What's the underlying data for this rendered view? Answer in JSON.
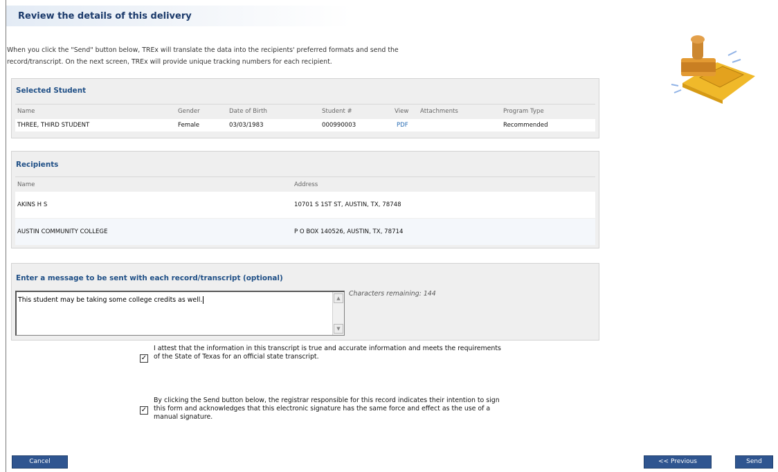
{
  "page": {
    "title": "Review the details of this delivery",
    "intro_line1": "When you click the \"Send\" button below, TREx will translate the data into the recipients' preferred formats and send the",
    "intro_line2": "record/transcript. On the next screen, TREx will provide unique tracking numbers for each recipient."
  },
  "student": {
    "section_title": "Selected Student",
    "headers": {
      "name": "Name",
      "gender": "Gender",
      "dob": "Date of Birth",
      "student_no": "Student #",
      "view": "View",
      "attachments": "Attachments",
      "program_type": "Program Type"
    },
    "row": {
      "name": "THREE, THIRD STUDENT",
      "gender": "Female",
      "dob": "03/03/1983",
      "student_no": "000990003",
      "view": "PDF",
      "attachments": "",
      "program_type": "Recommended"
    }
  },
  "recipients": {
    "section_title": "Recipients",
    "headers": {
      "name": "Name",
      "address": "Address"
    },
    "rows": [
      {
        "name": "AKINS H S",
        "address": "10701 S 1ST ST, AUSTIN, TX, 78748"
      },
      {
        "name": "AUSTIN COMMUNITY COLLEGE",
        "address": "P O BOX 140526, AUSTIN, TX, 78714"
      }
    ]
  },
  "message": {
    "section_title": "Enter a message to be sent with each record/transcript (optional)",
    "value": "This student may be taking some college credits as well.",
    "chars_remaining": "Characters remaining: 144"
  },
  "attestations": [
    {
      "checked": true,
      "line1": "I attest that the information in this transcript is true and accurate information and meets the requirements",
      "line2": "of the State of Texas for an official state transcript."
    },
    {
      "checked": true,
      "line1": "By clicking the Send button below, the registrar responsible for this record indicates their intention to sign",
      "line2": "this form and acknowledges that this electronic signature has the same force and effect as the use of a",
      "line3": "manual signature."
    }
  ],
  "buttons": {
    "cancel": "Cancel",
    "previous": "<< Previous",
    "send": "Send"
  },
  "colors": {
    "accent": "#2f5590",
    "section_title": "#1f4f86",
    "link": "#2a6eb5"
  },
  "icons": [
    "stamp-illustration-icon",
    "checkbox-checked-icon",
    "scroll-up-icon",
    "scroll-down-icon"
  ]
}
